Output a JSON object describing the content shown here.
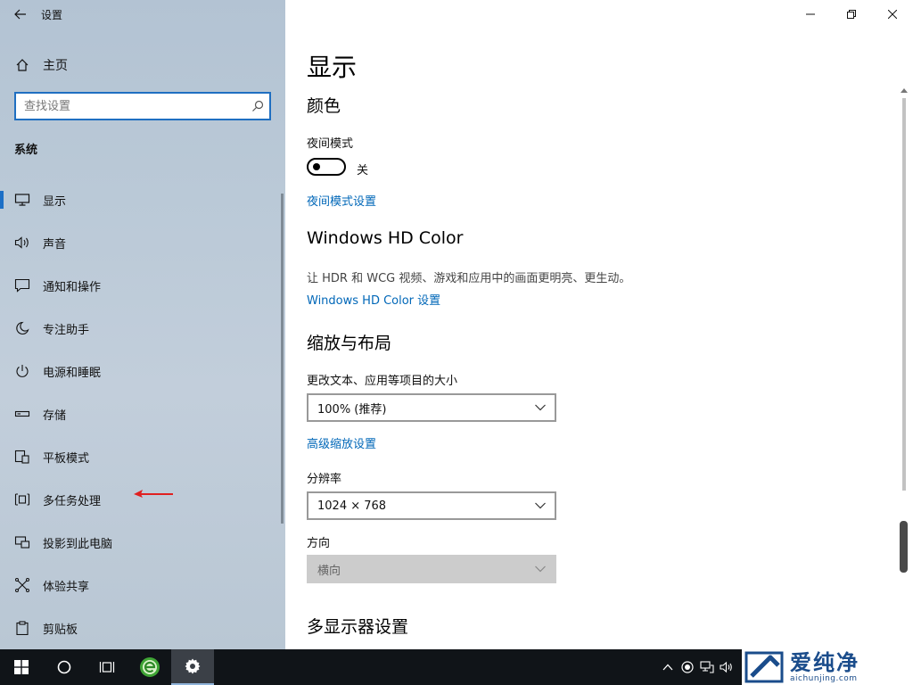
{
  "window": {
    "title": "设置"
  },
  "sidebar": {
    "home_label": "主页",
    "search_placeholder": "查找设置",
    "section_label": "系统",
    "items": [
      {
        "label": "显示",
        "icon": "monitor-icon",
        "active": true
      },
      {
        "label": "声音",
        "icon": "speaker-icon"
      },
      {
        "label": "通知和操作",
        "icon": "notification-icon"
      },
      {
        "label": "专注助手",
        "icon": "moon-icon"
      },
      {
        "label": "电源和睡眠",
        "icon": "power-icon"
      },
      {
        "label": "存储",
        "icon": "storage-icon"
      },
      {
        "label": "平板模式",
        "icon": "tablet-mode-icon"
      },
      {
        "label": "多任务处理",
        "icon": "multitasking-icon"
      },
      {
        "label": "投影到此电脑",
        "icon": "project-icon"
      },
      {
        "label": "体验共享",
        "icon": "share-icon"
      },
      {
        "label": "剪贴板",
        "icon": "clipboard-icon"
      }
    ]
  },
  "main": {
    "title": "显示",
    "color": {
      "heading": "颜色",
      "night_light_label": "夜间模式",
      "toggle_state": "关",
      "night_light_link": "夜间模式设置"
    },
    "hdr": {
      "heading": "Windows HD Color",
      "description": "让 HDR 和 WCG 视频、游戏和应用中的画面更明亮、更生动。",
      "link": "Windows HD Color 设置"
    },
    "scale": {
      "heading": "缩放与布局",
      "size_label": "更改文本、应用等项目的大小",
      "size_value": "100% (推荐)",
      "advanced_link": "高级缩放设置",
      "resolution_label": "分辨率",
      "resolution_value": "1024 × 768",
      "orientation_label": "方向",
      "orientation_value": "横向"
    },
    "multi_display": {
      "heading": "多显示器设置"
    }
  },
  "watermark": {
    "main": "爱纯净",
    "sub": "aichunjing.com"
  },
  "colors": {
    "accent": "#0067b8",
    "active_indicator": "#1c6fc6",
    "taskbar": "#101418"
  }
}
